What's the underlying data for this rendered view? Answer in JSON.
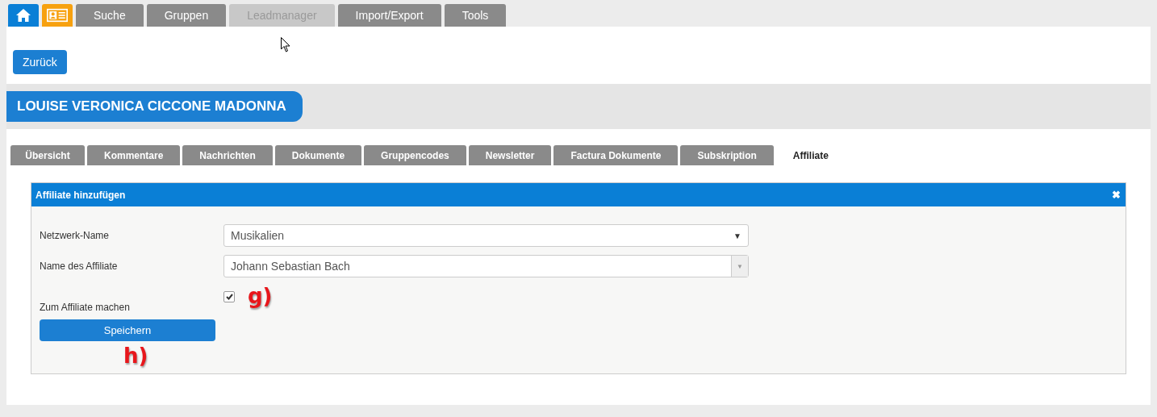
{
  "top_tabs": [
    {
      "kind": "home"
    },
    {
      "kind": "contact"
    },
    {
      "kind": "text",
      "label": "Suche",
      "disabled": false
    },
    {
      "kind": "text",
      "label": "Gruppen",
      "disabled": false
    },
    {
      "kind": "text",
      "label": "Leadmanager",
      "disabled": true
    },
    {
      "kind": "text",
      "label": "Import/Export",
      "disabled": false
    },
    {
      "kind": "text",
      "label": "Tools",
      "disabled": false
    }
  ],
  "back_button": "Zurück",
  "contact_name": "LOUISE VERONICA CICCONE MADONNA",
  "detail_tabs": [
    {
      "label": "Übersicht",
      "selected": false
    },
    {
      "label": "Kommentare",
      "selected": false
    },
    {
      "label": "Nachrichten",
      "selected": false
    },
    {
      "label": "Dokumente",
      "selected": false
    },
    {
      "label": "Gruppencodes",
      "selected": false
    },
    {
      "label": "Newsletter",
      "selected": false
    },
    {
      "label": "Factura Dokumente",
      "selected": false
    },
    {
      "label": "Subskription",
      "selected": false
    },
    {
      "label": "Affiliate",
      "selected": true
    }
  ],
  "panel": {
    "title": "Affiliate hinzufügen",
    "close": "✖",
    "fields": [
      {
        "kind": "select",
        "label": "Netzwerk-Name",
        "value": "Musikalien",
        "arrow": "▼"
      },
      {
        "kind": "combo",
        "label": "Name des Affiliate",
        "value": "Johann Sebastian Bach",
        "arrow": "▼"
      },
      {
        "kind": "checkbox",
        "label": "Zum Affiliate machen",
        "checked": true,
        "annotation": "g)"
      }
    ],
    "save_button": "Speichern",
    "save_annotation": "h)"
  }
}
